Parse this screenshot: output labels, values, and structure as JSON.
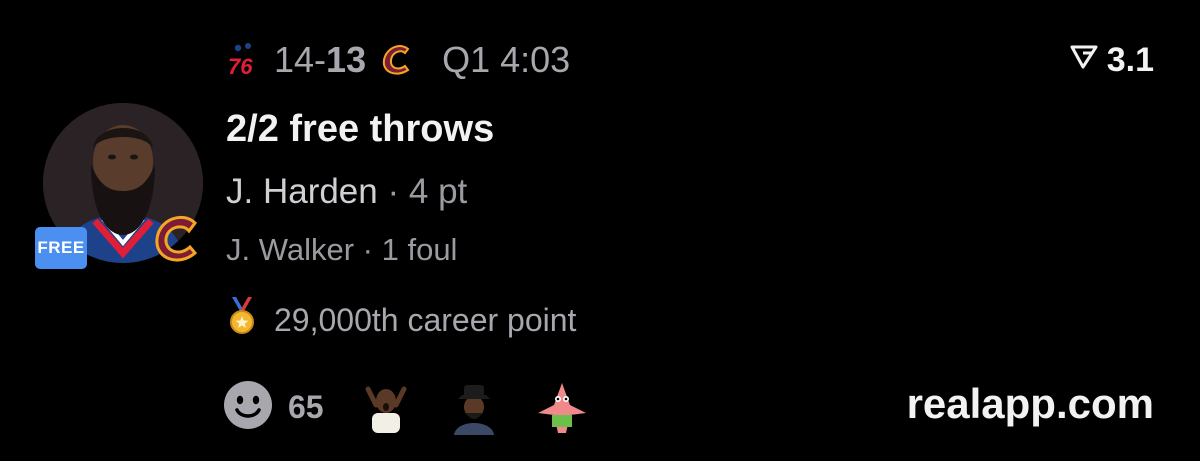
{
  "header": {
    "home_team_logo": "76ers-logo",
    "home_score": "14",
    "separator": "-",
    "away_score": "13",
    "away_team_logo": "cavaliers-logo",
    "game_clock": "Q1 4:03"
  },
  "rating": {
    "icon": "rank-arrow-icon",
    "value": "3.1"
  },
  "player": {
    "avatar": "player-avatar",
    "badge_label": "FREE",
    "team_badge": "cavaliers-c-logo"
  },
  "play": {
    "title": "2/2 free throws",
    "primary_player": "J. Harden",
    "primary_sep": "·",
    "primary_stat": "4 pt",
    "secondary_player": "J. Walker",
    "secondary_sep": "·",
    "secondary_stat": "1 foul"
  },
  "achievement": {
    "icon": "medal-icon",
    "text": "29,000th career point"
  },
  "reactions": {
    "icon": "smiley-face-icon",
    "count": "65",
    "stickers": [
      "reaction-sticker-shocked-man",
      "reaction-sticker-man-hat",
      "reaction-sticker-patrick"
    ]
  },
  "footer": {
    "site": "realapp.com"
  },
  "colors": {
    "background": "#000000",
    "muted_text": "#a7a7ad",
    "primary_text": "#f2f2f2",
    "free_badge": "#4b8ff0",
    "sixers_blue": "#1d428a",
    "sixers_red": "#e01e38",
    "cavs_wine": "#7a1d35",
    "cavs_gold": "#f5a623"
  }
}
